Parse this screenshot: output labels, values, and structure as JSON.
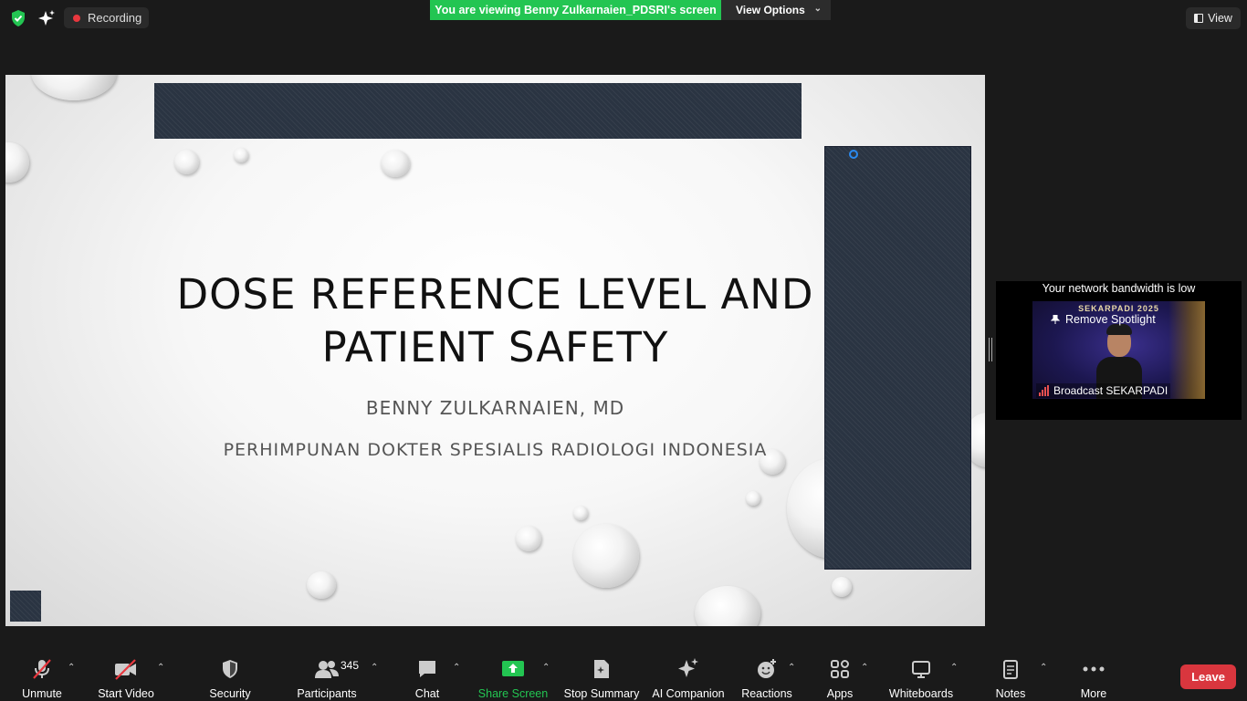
{
  "topbar": {
    "recording_label": "Recording",
    "viewing_banner": "You are viewing Benny Zulkarnaien_PDSRI's screen",
    "view_options_label": "View Options",
    "view_label": "View"
  },
  "slide": {
    "title_line1": "DOSE REFERENCE LEVEL AND",
    "title_line2": "PATIENT SAFETY",
    "author": "BENNY ZULKARNAIEN, MD",
    "organization": "PERHIMPUNAN DOKTER SPESIALIS RADIOLOGI INDONESIA"
  },
  "side_panel": {
    "bandwidth_notice": "Your network bandwidth is low",
    "spotlight_label": "Remove Spotlight",
    "participant_name": "Broadcast SEKARPADI",
    "video_banner": "SEKARPADI 2025"
  },
  "toolbar": {
    "unmute": "Unmute",
    "start_video": "Start Video",
    "security": "Security",
    "participants": "Participants",
    "participants_count": "345",
    "chat": "Chat",
    "share_screen": "Share Screen",
    "stop_summary": "Stop Summary",
    "ai_companion": "AI Companion",
    "reactions": "Reactions",
    "apps": "Apps",
    "whiteboards": "Whiteboards",
    "notes": "Notes",
    "more": "More",
    "leave": "Leave"
  },
  "colors": {
    "share_green": "#23c552",
    "leave_red": "#d9363e",
    "background": "#1a1a1a"
  }
}
